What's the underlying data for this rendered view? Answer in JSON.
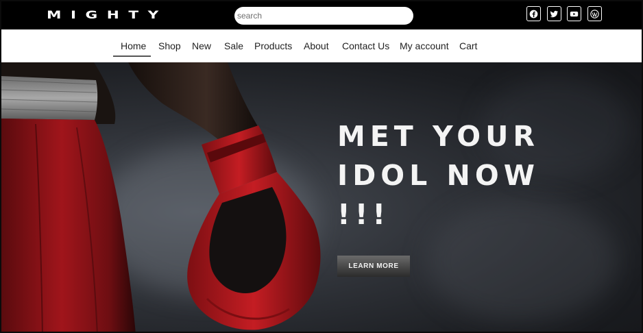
{
  "brand": {
    "logo_text": "MIGHTY"
  },
  "search": {
    "placeholder": "search"
  },
  "social": [
    {
      "name": "facebook-icon"
    },
    {
      "name": "twitter-icon"
    },
    {
      "name": "youtube-icon"
    },
    {
      "name": "wordpress-icon"
    }
  ],
  "nav": {
    "items": [
      "Home",
      "Shop",
      "New",
      "Sale",
      "Products",
      "About",
      "Contact Us",
      "My account",
      "Cart"
    ],
    "active": "Home"
  },
  "hero": {
    "headline_lines": [
      "MET YOUR",
      "IDOL NOW",
      "!!!"
    ],
    "button_label": "LEARN MORE"
  },
  "colors": {
    "topbar_bg": "#000000",
    "nav_bg": "#ffffff",
    "glove_red": "#b3161c",
    "hero_text": "#f4f4f4"
  }
}
